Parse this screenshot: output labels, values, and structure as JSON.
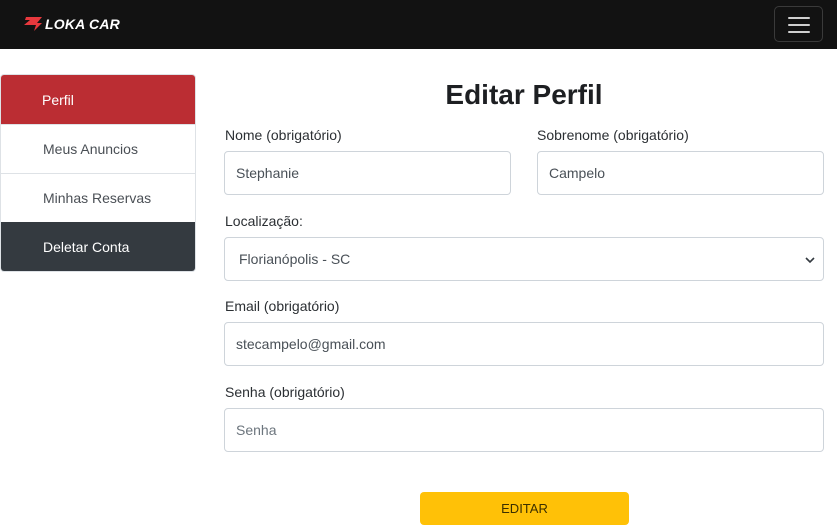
{
  "brand": {
    "name": "LOKA CAR",
    "logo_color": "#e8383d"
  },
  "navbar": {
    "toggle_icon": "hamburger-icon"
  },
  "sidebar": {
    "items": [
      {
        "label": "Perfil",
        "state": "active"
      },
      {
        "label": "Meus Anuncios",
        "state": "default"
      },
      {
        "label": "Minhas Reservas",
        "state": "default"
      },
      {
        "label": "Deletar Conta",
        "state": "danger-dark"
      }
    ]
  },
  "form": {
    "title": "Editar Perfil",
    "nome": {
      "label": "Nome (obrigatório)",
      "value": "Stephanie"
    },
    "sobrenome": {
      "label": "Sobrenome (obrigatório)",
      "value": "Campelo"
    },
    "localizacao": {
      "label": "Localização:",
      "value": "Florianópolis - SC"
    },
    "email": {
      "label": "Email (obrigatório)",
      "value": "stecampelo@gmail.com"
    },
    "senha": {
      "label": "Senha (obrigatório)",
      "placeholder": "Senha",
      "value": ""
    },
    "submit_label": "EDITAR"
  },
  "colors": {
    "navbar": "#121212",
    "active": "#bb2d33",
    "dark": "#343a40",
    "button": "#ffc107"
  }
}
